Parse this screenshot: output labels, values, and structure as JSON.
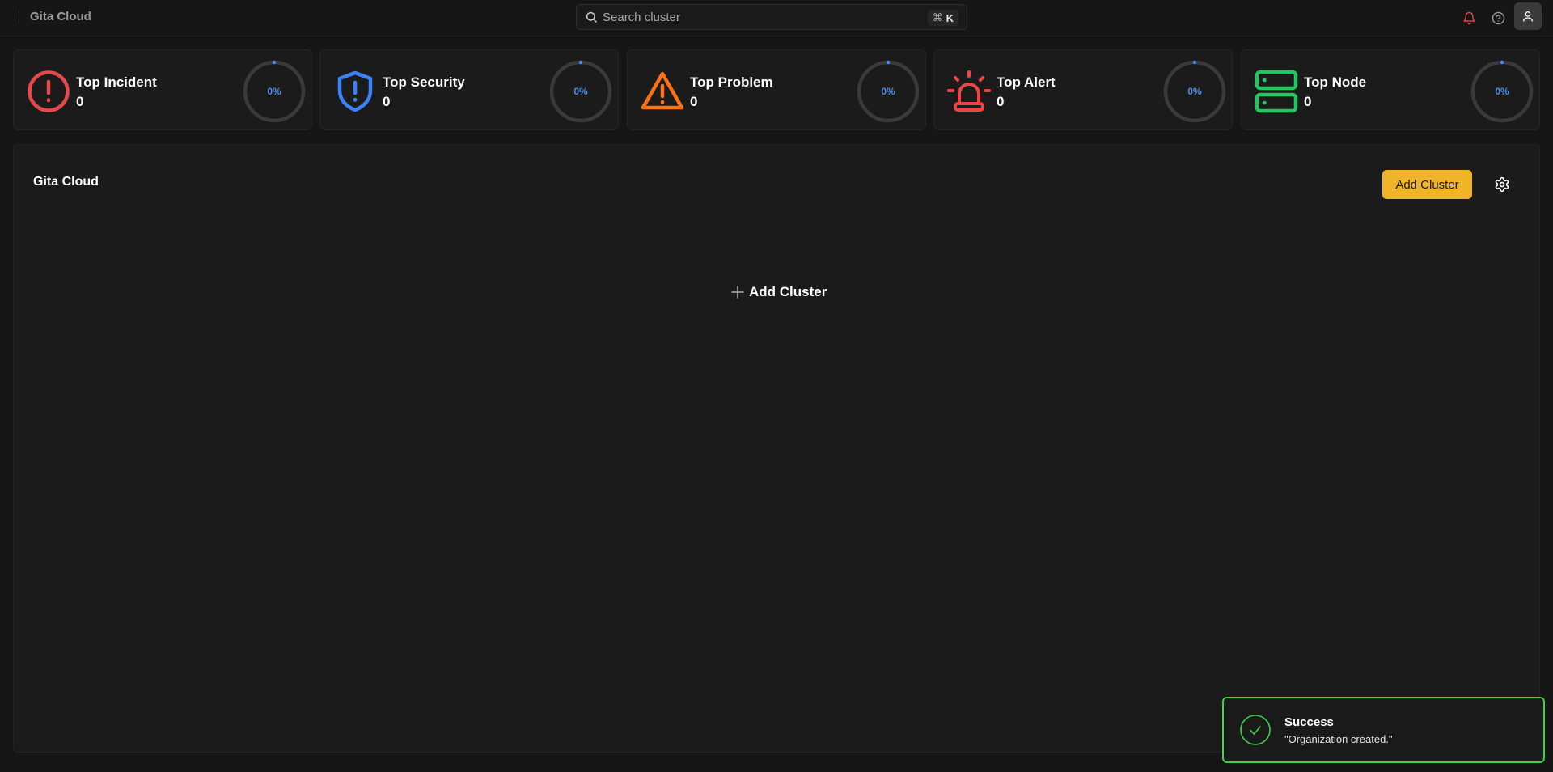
{
  "header": {
    "brand": "Gita Cloud",
    "search": {
      "placeholder": "Search cluster",
      "shortcut_symbol": "⌘",
      "shortcut_key": "K"
    },
    "icons": [
      "bell-icon",
      "help-icon",
      "user-icon"
    ]
  },
  "stats": [
    {
      "title": "Top Incident",
      "value": "0",
      "percent_label": "0%",
      "percent": 0,
      "icon": "alert-circle-icon",
      "color": "#e5484d"
    },
    {
      "title": "Top Security",
      "value": "0",
      "percent_label": "0%",
      "percent": 0,
      "icon": "shield-alert-icon",
      "color": "#3b82f6"
    },
    {
      "title": "Top Problem",
      "value": "0",
      "percent_label": "0%",
      "percent": 0,
      "icon": "warning-triangle-icon",
      "color": "#f97316"
    },
    {
      "title": "Top Alert",
      "value": "0",
      "percent_label": "0%",
      "percent": 0,
      "icon": "siren-icon",
      "color": "#ef4444"
    },
    {
      "title": "Top Node",
      "value": "0",
      "percent_label": "0%",
      "percent": 0,
      "icon": "server-icon",
      "color": "#22c55e"
    }
  ],
  "main": {
    "title": "Gita Cloud",
    "add_cluster_label": "Add Cluster",
    "empty_add_label": "Add Cluster"
  },
  "toast": {
    "title": "Success",
    "message": "\"Organization created.\"",
    "color": "#3ed14a"
  },
  "colors": {
    "accent": "#f0b429",
    "ring_track": "#3a3a3a",
    "ring_progress": "#4f8fe8"
  }
}
